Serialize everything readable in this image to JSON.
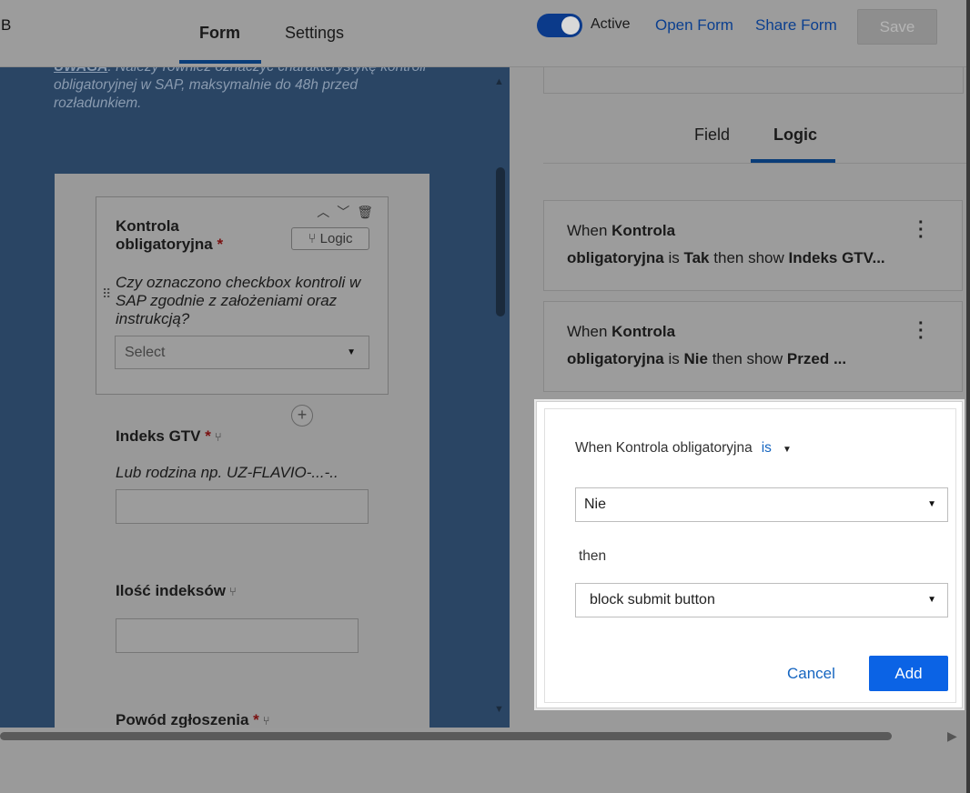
{
  "header": {
    "brand": "B",
    "tabs": [
      {
        "label": "Form",
        "active": true
      },
      {
        "label": "Settings",
        "active": false
      }
    ],
    "active_toggle": {
      "label": "Active",
      "on": true
    },
    "open_form_label": "Open Form",
    "share_form_label": "Share Form",
    "save_label": "Save"
  },
  "form": {
    "note_warning": "UWAGA",
    "note_text": ": Należy również oznaczyć charakterystykę kontroli obligatoryjnej w SAP, maksymalnie do 48h przed rozładunkiem.",
    "selected_field": {
      "label": "Kontrola obligatoryjna",
      "required_mark": "*",
      "logic_button": "Logic",
      "question": "Czy oznaczono checkbox kontroli w SAP zgodnie z założeniami oraz instrukcją?",
      "select_placeholder": "Select"
    },
    "fields": [
      {
        "label": "Indeks GTV",
        "required_mark": "*",
        "help": "Lub rodzina np. UZ-FLAVIO-...-.."
      },
      {
        "label": "Ilość indeksów",
        "required_mark": ""
      },
      {
        "label": "Powód zgłoszenia",
        "required_mark": "*"
      }
    ]
  },
  "right_panel": {
    "tabs": [
      {
        "label": "Field",
        "active": false
      },
      {
        "label": "Logic",
        "active": true
      }
    ],
    "rules": [
      {
        "when": "When",
        "field_line1": "Kontrola",
        "field_line2": "obligatoryjna",
        "op": "is",
        "value": "Tak",
        "then": "then show",
        "target": "Indeks GTV..."
      },
      {
        "when": "When",
        "field_line1": "Kontrola",
        "field_line2": "obligatoryjna",
        "op": "is",
        "value": "Nie",
        "then": "then show",
        "target": "Przed ..."
      }
    ]
  },
  "dialog": {
    "condition_prefix": "When Kontrola obligatoryjna",
    "operator": "is",
    "value_select": "Nie",
    "then_label": "then",
    "action_select": "block submit button",
    "cancel_label": "Cancel",
    "add_label": "Add"
  },
  "colors": {
    "accent": "#0b63e5",
    "link": "#1565c0",
    "left_pane_bg": "#2a4564",
    "tab_underline": "#0a3d78"
  }
}
